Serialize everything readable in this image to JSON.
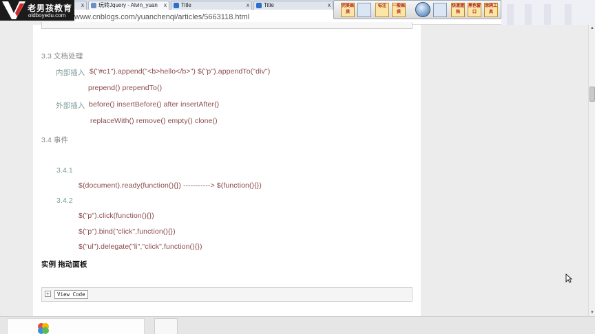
{
  "logo": {
    "line1": "老男孩教育",
    "line2": "oldboyedu.com"
  },
  "tabs": [
    {
      "title": "",
      "close": "x"
    },
    {
      "title": "玩转Jquery - Alvin_yuan",
      "close": "x"
    },
    {
      "title": "Title",
      "close": "x"
    },
    {
      "title": "Title",
      "close": "x"
    }
  ],
  "address_bar": {
    "url": "www.cnblogs.com/yuanchenqi/articles/5663118.html"
  },
  "toolbar": {
    "buttons": [
      "完美画质",
      "",
      "标注",
      "一般画质",
      "",
      "快速遮挡",
      "黑色窗口",
      "涂鸦工具"
    ]
  },
  "article": {
    "s33_title": "3.3 文档处理",
    "inner_label": "内部插入",
    "inner_line1": "$(\"#c1\").append(\"<b>hello</b>\")     $(\"p\").appendTo(\"div\")",
    "inner_line2": "prepend()    prependTo()",
    "outer_label": "外部插入",
    "outer_line1": "before()  insertBefore()  after insertAfter()",
    "outer_line2": "replaceWith()   remove()  empty()  clone()",
    "s34_title": "3.4 事件",
    "s341": "3.4.1",
    "s341_code": "$(document).ready(function(){}) -----------> $(function(){})",
    "s342": "3.4.2",
    "s342_code1": "$(\"p\").click(function(){})",
    "s342_code2": "$(\"p\").bind(\"click\",function(){})",
    "s342_code3": "$(\"ul\").delegate(\"li\",\"click\",function(){})",
    "example_title": "实例 拖动面板",
    "expand_symbol": "+",
    "view_code": "View Code"
  }
}
